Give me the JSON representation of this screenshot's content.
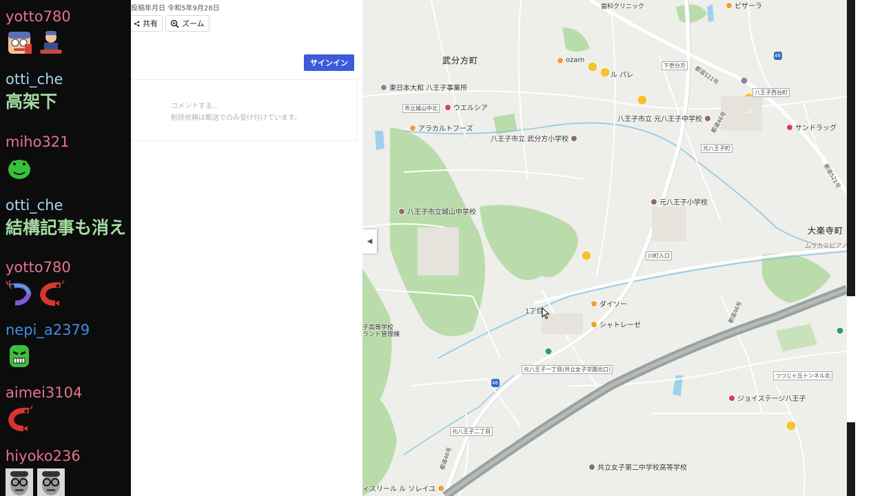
{
  "chat": {
    "messages": [
      {
        "user": "yotto780",
        "user_color": "#e8728e",
        "text": "",
        "emotes": [
          "ojisan-face-emote",
          "ojisan-seated-emote"
        ]
      },
      {
        "user": "otti_che",
        "user_color": "#a9d6e8",
        "text": "高架下",
        "emotes": []
      },
      {
        "user": "miho321",
        "user_color": "#e8728e",
        "text": "",
        "emotes": [
          "green-frog-emote"
        ]
      },
      {
        "user": "otti_che",
        "user_color": "#a9d6e8",
        "text": "結構記事も消え",
        "emotes": []
      },
      {
        "user": "yotto780",
        "user_color": "#e8728e",
        "text": "",
        "emotes": [
          "colorful-shrimp-emote",
          "red-shrimp-emote"
        ]
      },
      {
        "user": "nepi_a2379",
        "user_color": "#3f8fe0",
        "text": "",
        "emotes": [
          "green-angry-face-emote"
        ]
      },
      {
        "user": "aimei3104",
        "user_color": "#e8728e",
        "text": "",
        "emotes": [
          "red-shrimp-emote"
        ]
      },
      {
        "user": "hiyoko236",
        "user_color": "#e8728e",
        "text": "",
        "emotes": [
          "glasses-man-photo-emote",
          "glasses-man-photo-emote"
        ]
      }
    ]
  },
  "page": {
    "date_text": "投稿年月日 令和5年9月28日",
    "share_label": "共有",
    "zoom_label": "ズーム",
    "signin_label": "サインイン",
    "comment_placeholder": "コメントする...",
    "comment_note": "削除依頼は郵送でのみ受け付けています。"
  },
  "map": {
    "collapse_icon": "chevron-left-icon",
    "areas": [
      "武分方町",
      "大楽寺町"
    ],
    "places": [
      {
        "name": "東日本大和 八王子事業所",
        "pin": "gray"
      },
      {
        "name": "市立城山中北",
        "pin": "none"
      },
      {
        "name": "ウエルシア",
        "pin": "pink"
      },
      {
        "name": "アラカルトフーズ",
        "pin": "orange"
      },
      {
        "name": "八王子市立 武分方小学校",
        "pin": "brown"
      },
      {
        "name": "ozam",
        "pin": "orange"
      },
      {
        "name": "ル パレ",
        "pin": "none"
      },
      {
        "name": "八王子市立 元八王子中学校",
        "pin": "brown"
      },
      {
        "name": "サンドラッグ",
        "pin": "pink"
      },
      {
        "name": "八王子市立城山中学校",
        "pin": "brown"
      },
      {
        "name": "元八王子小学校",
        "pin": "brown"
      },
      {
        "name": "ダイソー",
        "pin": "orange"
      },
      {
        "name": "シャトレーゼ",
        "pin": "orange"
      },
      {
        "name": "ジョイステージ八王子",
        "pin": "pink"
      },
      {
        "name": "共立女子第二中学校高等学校",
        "pin": "brown"
      },
      {
        "name": "ムラカミピアノサー",
        "pin": "none"
      },
      {
        "name": "ピザーラ",
        "pin": "orange"
      },
      {
        "name": "歯科クリニック",
        "pin": "none"
      },
      {
        "name": "子高等学校",
        "pin": "none"
      },
      {
        "name": "ランド管理棟",
        "pin": "none"
      },
      {
        "name": "ィスリール ル ソレイユ",
        "pin": "orange"
      }
    ],
    "signs": [
      "下壱分方",
      "八王子西台町",
      "元八王子町",
      "川町入口",
      "元八王子一丁目(共立女子学園北口)",
      "元八王子二丁目",
      "つつじヶ丘トンネル北"
    ],
    "routes": [
      "都道521号",
      "都道46号",
      "46",
      "521"
    ],
    "block_label": "1丁目"
  }
}
